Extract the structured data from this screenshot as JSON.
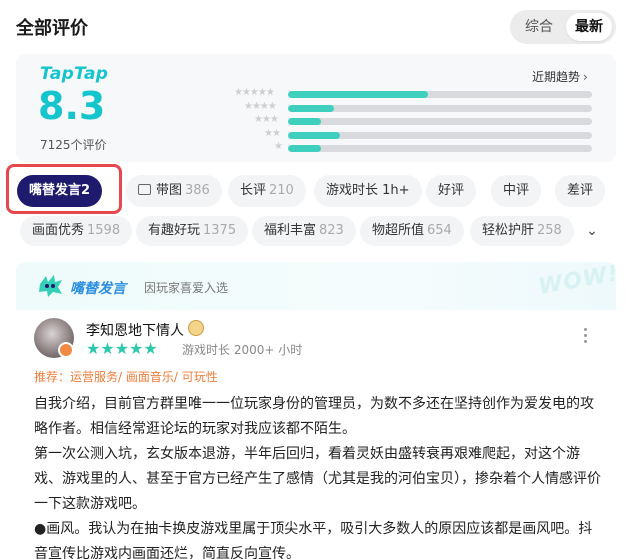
{
  "header": {
    "title": "全部评价",
    "sort_options": [
      "综合",
      "最新"
    ],
    "sort_selected": "最新"
  },
  "rating": {
    "brand": "TapTap",
    "score": "8.3",
    "count_text": "7125个评价",
    "trend_link": "近期趋势",
    "distribution": [
      {
        "stars": 5,
        "fraction": 0.46
      },
      {
        "stars": 4,
        "fraction": 0.15
      },
      {
        "stars": 3,
        "fraction": 0.11
      },
      {
        "stars": 2,
        "fraction": 0.17
      },
      {
        "stars": 1,
        "fraction": 0.11
      }
    ]
  },
  "filters_row1": [
    {
      "label": "嘴替发言",
      "count": "2"
    },
    {
      "label": "带图",
      "count": "386"
    },
    {
      "label": "长评",
      "count": "210"
    },
    {
      "label": "游戏时长 1h+",
      "count": ""
    },
    {
      "label": "好评",
      "count": ""
    },
    {
      "label": "中评",
      "count": ""
    },
    {
      "label": "差评",
      "count": ""
    }
  ],
  "filters_row2": [
    {
      "label": "画面优秀",
      "count": "1598"
    },
    {
      "label": "有趣好玩",
      "count": "1375"
    },
    {
      "label": "福利丰富",
      "count": "823"
    },
    {
      "label": "物超所值",
      "count": "654"
    },
    {
      "label": "轻松护肝",
      "count": "258"
    }
  ],
  "review": {
    "banner_title": "嘴替发言",
    "banner_sub": "因玩家喜爱入选",
    "banner_deco": "WOW!",
    "username": "李知恩地下情人",
    "stars": 5,
    "playtime": "游戏时长 2000+ 小时",
    "recommend": "推荐：运营服务/ 画面音乐/ 可玩性",
    "paragraphs": [
      "自我介绍，目前官方群里唯一一位玩家身份的管理员，为数不多还在坚持创作为爱发电的攻略作者。相信经常逛论坛的玩家对我应该都不陌生。",
      "第一次公测入坑，玄女版本退游，半年后回归，看着灵妖由盛转衰再艰难爬起，对这个游戏、游戏里的人、甚至于官方已经产生了感情（尤其是我的河伯宝贝），掺杂着个人情感评价一下这款游戏吧。",
      "●画风。我认为在抽卡换皮游戏里属于顶尖水平，吸引大多数人的原因应该都是画风吧。抖音宣传比游戏内画面还烂，简直反向宣传。"
    ]
  },
  "colors": {
    "accent": "#15c5ce",
    "bar": "#3fcfbf",
    "active_tag": "#1e1b6e",
    "highlight": "#e5484d",
    "recommend": "#f07e3a",
    "star": "#2ec9ac"
  }
}
